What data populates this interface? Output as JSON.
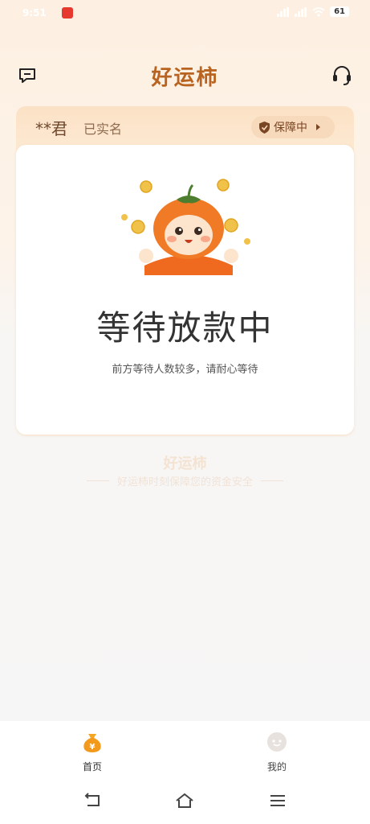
{
  "status_bar": {
    "time": "9:51",
    "battery": "61"
  },
  "header": {
    "title": "好运柿"
  },
  "user": {
    "name": "**君",
    "verified": "已实名",
    "guarantee": "保障中"
  },
  "main": {
    "status": "等待放款中",
    "subtitle": "前方等待人数较多，请耐心等待"
  },
  "watermark": {
    "brand": "好运柿",
    "slogan": "好运柿时刻保障您的资金安全"
  },
  "tabs": [
    {
      "label": "首页",
      "active": true
    },
    {
      "label": "我的",
      "active": false
    }
  ],
  "colors": {
    "brand": "#b86420",
    "accent": "#f39a1d",
    "text": "#333333"
  }
}
